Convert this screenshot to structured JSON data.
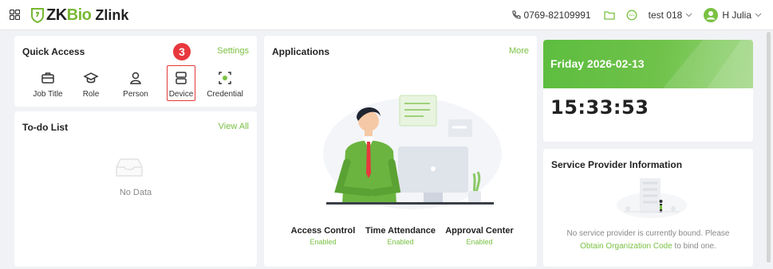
{
  "brand": {
    "zk": "ZK",
    "bio": "Bio",
    "product": "Zlink",
    "accent": "#7ac143"
  },
  "topbar": {
    "phone": "0769-82109991",
    "company": "test 018",
    "user": "H Julia"
  },
  "quick_access": {
    "title": "Quick Access",
    "settings": "Settings",
    "items": [
      {
        "label": "Job Title",
        "icon": "briefcase-icon"
      },
      {
        "label": "Role",
        "icon": "graduation-cap-icon"
      },
      {
        "label": "Person",
        "icon": "person-icon"
      },
      {
        "label": "Device",
        "icon": "device-icon"
      },
      {
        "label": "Credential",
        "icon": "credential-icon"
      }
    ],
    "step_badge": "3",
    "highlight_color": "#e03a3a"
  },
  "todo": {
    "title": "To-do List",
    "view_all": "View All",
    "empty_text": "No Data"
  },
  "applications": {
    "title": "Applications",
    "more": "More",
    "apps": [
      {
        "name": "Access Control",
        "status": "Enabled"
      },
      {
        "name": "Time Attendance",
        "status": "Enabled"
      },
      {
        "name": "Approval Center",
        "status": "Enabled"
      }
    ]
  },
  "datetime": {
    "date": "Friday 2026-02-13",
    "time": "15:33:53"
  },
  "service_provider": {
    "title": "Service Provider Information",
    "text_before": "No service provider is currently bound. Please",
    "link": "Obtain Organization Code",
    "text_after": " to bind one."
  }
}
